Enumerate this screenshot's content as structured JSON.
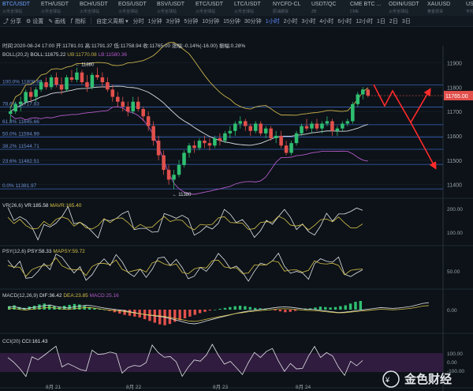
{
  "tickers": [
    {
      "name": "BTC/USDT",
      "sub": "火币全球站",
      "active": true
    },
    {
      "name": "ETH/USDT",
      "sub": "火币全球站"
    },
    {
      "name": "BCH/USDT",
      "sub": "火币全球站"
    },
    {
      "name": "EOS/USDT",
      "sub": "火币全球站"
    },
    {
      "name": "BSV/USDT",
      "sub": "火币全球站"
    },
    {
      "name": "ETC/USDT",
      "sub": "火币全球站"
    },
    {
      "name": "LTC/USDT",
      "sub": "火币全球站"
    },
    {
      "name": "NYCFD-CL",
      "sub": "原油期货"
    },
    {
      "name": "USDT/QC",
      "sub": "ZB"
    },
    {
      "name": "CME BTC ...",
      "sub": "CME"
    },
    {
      "name": "ODIN/USDT",
      "sub": "火币全球站"
    },
    {
      "name": "XAUUSD",
      "sub": "黄金现货"
    },
    {
      "name": "USDT / CNY",
      "sub": "平均价"
    }
  ],
  "toolbar": {
    "share": "分享",
    "settings": "设置",
    "draw": "画线",
    "indicators": "指标",
    "custom": "自定义周期",
    "intervals": [
      "分时",
      "1分钟",
      "3分钟",
      "5分钟",
      "10分钟",
      "15分钟",
      "30分钟",
      "1小时",
      "2小时",
      "3小时",
      "4小时",
      "6小时",
      "12小时",
      "1日",
      "2日",
      "3日"
    ],
    "active_interval": "1小时"
  },
  "chart_data": {
    "type": "candlestick",
    "symbol": "BTC/USDT",
    "info": {
      "time_label": "时间:",
      "time": "2020-08-24 17:00",
      "open_label": "开:",
      "open": "11781.01",
      "high_label": "高:",
      "high": "11791.37",
      "low_label": "低:",
      "low": "11758.94",
      "close_label": "收:",
      "close": "11765.00",
      "chg_label": "涨幅:",
      "chg": "-0.14%(-16.00)",
      "amp_label": "振幅:",
      "amp": "0.28%"
    },
    "boll": {
      "label": "BOLL(20,2)",
      "boll": "BOLL:11675.22",
      "ub": "UB:11770.08",
      "lb": "LB:11580.36"
    },
    "price_axis": {
      "min": 11350,
      "max": 11950,
      "ticks": [
        11900,
        11800,
        11700,
        11600,
        11500,
        11400
      ]
    },
    "current_price": "11765.00",
    "fib": [
      {
        "label": "100.0%",
        "price": "11808.89",
        "value": 11808.89
      },
      {
        "label": "78.6%",
        "price": "11717.83",
        "value": 11717.83
      },
      {
        "label": "61.8%",
        "price": "11645.66",
        "value": 11645.66
      },
      {
        "label": "50.0%",
        "price": "11594.99",
        "value": 11594.99
      },
      {
        "label": "38.2%",
        "price": "11544.71",
        "value": 11544.71
      },
      {
        "label": "23.6%",
        "price": "11482.51",
        "value": 11482.51
      },
      {
        "label": "0.0%",
        "price": "11381.97",
        "value": 11381.97
      }
    ],
    "annotations": {
      "high": "11880",
      "low": "11380"
    },
    "x_labels": [
      "8月 21",
      "8月 22",
      "8月 23",
      "8月 24"
    ],
    "candles": [
      [
        11690,
        11720,
        11660,
        11700
      ],
      [
        11700,
        11740,
        11690,
        11730
      ],
      [
        11730,
        11760,
        11700,
        11740
      ],
      [
        11740,
        11790,
        11730,
        11780
      ],
      [
        11780,
        11800,
        11740,
        11760
      ],
      [
        11760,
        11800,
        11740,
        11790
      ],
      [
        11790,
        11830,
        11780,
        11820
      ],
      [
        11820,
        11840,
        11790,
        11800
      ],
      [
        11800,
        11850,
        11790,
        11840
      ],
      [
        11840,
        11860,
        11800,
        11810
      ],
      [
        11810,
        11840,
        11770,
        11790
      ],
      [
        11790,
        11850,
        11780,
        11840
      ],
      [
        11840,
        11870,
        11820,
        11830
      ],
      [
        11830,
        11880,
        11820,
        11860
      ],
      [
        11860,
        11870,
        11810,
        11820
      ],
      [
        11820,
        11850,
        11780,
        11800
      ],
      [
        11800,
        11860,
        11790,
        11850
      ],
      [
        11850,
        11880,
        11830,
        11840
      ],
      [
        11840,
        11860,
        11800,
        11820
      ],
      [
        11820,
        11840,
        11780,
        11790
      ],
      [
        11790,
        11810,
        11740,
        11760
      ],
      [
        11760,
        11780,
        11720,
        11740
      ],
      [
        11740,
        11760,
        11700,
        11720
      ],
      [
        11720,
        11740,
        11680,
        11700
      ],
      [
        11700,
        11760,
        11690,
        11740
      ],
      [
        11740,
        11760,
        11700,
        11710
      ],
      [
        11710,
        11720,
        11660,
        11680
      ],
      [
        11680,
        11700,
        11620,
        11640
      ],
      [
        11640,
        11660,
        11560,
        11580
      ],
      [
        11580,
        11600,
        11500,
        11520
      ],
      [
        11520,
        11540,
        11440,
        11460
      ],
      [
        11460,
        11480,
        11400,
        11420
      ],
      [
        11420,
        11460,
        11380,
        11440
      ],
      [
        11440,
        11500,
        11430,
        11480
      ],
      [
        11480,
        11540,
        11470,
        11530
      ],
      [
        11530,
        11570,
        11510,
        11560
      ],
      [
        11560,
        11580,
        11530,
        11550
      ],
      [
        11550,
        11590,
        11540,
        11580
      ],
      [
        11580,
        11600,
        11550,
        11570
      ],
      [
        11570,
        11590,
        11540,
        11560
      ],
      [
        11560,
        11600,
        11550,
        11590
      ],
      [
        11590,
        11610,
        11560,
        11580
      ],
      [
        11580,
        11620,
        11570,
        11610
      ],
      [
        11610,
        11640,
        11590,
        11620
      ],
      [
        11620,
        11660,
        11600,
        11650
      ],
      [
        11650,
        11680,
        11630,
        11660
      ],
      [
        11660,
        11670,
        11620,
        11640
      ],
      [
        11640,
        11650,
        11600,
        11620
      ],
      [
        11620,
        11660,
        11610,
        11650
      ],
      [
        11650,
        11660,
        11600,
        11610
      ],
      [
        11610,
        11640,
        11590,
        11630
      ],
      [
        11630,
        11640,
        11580,
        11590
      ],
      [
        11590,
        11620,
        11570,
        11600
      ],
      [
        11600,
        11620,
        11550,
        11560
      ],
      [
        11560,
        11580,
        11520,
        11530
      ],
      [
        11530,
        11580,
        11520,
        11570
      ],
      [
        11570,
        11620,
        11560,
        11610
      ],
      [
        11610,
        11650,
        11600,
        11640
      ],
      [
        11640,
        11670,
        11620,
        11630
      ],
      [
        11630,
        11660,
        11610,
        11650
      ],
      [
        11650,
        11670,
        11620,
        11630
      ],
      [
        11630,
        11660,
        11610,
        11650
      ],
      [
        11650,
        11680,
        11640,
        11660
      ],
      [
        11660,
        11670,
        11600,
        11620
      ],
      [
        11620,
        11640,
        11600,
        11630
      ],
      [
        11630,
        11660,
        11620,
        11650
      ],
      [
        11650,
        11670,
        11640,
        11660
      ],
      [
        11660,
        11740,
        11650,
        11730
      ],
      [
        11730,
        11780,
        11720,
        11770
      ],
      [
        11770,
        11800,
        11750,
        11790
      ],
      [
        11790,
        11795,
        11758,
        11765
      ]
    ],
    "projection": [
      [
        474,
        107
      ],
      [
        488,
        134
      ],
      [
        498,
        115
      ],
      [
        521,
        155
      ],
      [
        545,
        114
      ]
    ],
    "projection_alt": [
      [
        521,
        155
      ],
      [
        552,
        212
      ]
    ],
    "vr": {
      "label": "VR(26,6)",
      "vr": "VR:185.58",
      "mavr": "MAVR:165.40",
      "ticks": [
        "200.00",
        "100.00"
      ]
    },
    "psy": {
      "label": "PSY(12,6)",
      "psy": "PSY:58.33",
      "mapsy": "MAPSY:59.72",
      "tick": "50.00"
    },
    "macd": {
      "label": "MACD(12,26,9)",
      "dif": "DIF:36.42",
      "dea": "DEA:23.85",
      "macd": "MACD:25.16",
      "tick": "0.00",
      "hist": [
        8,
        10,
        6,
        4,
        7,
        9,
        12,
        14,
        10,
        8,
        6,
        9,
        11,
        13,
        12,
        9,
        6,
        4,
        2,
        0,
        -3,
        -6,
        -9,
        -12,
        -14,
        -16,
        -18,
        -22,
        -26,
        -30,
        -34,
        -36,
        -33,
        -28,
        -24,
        -20,
        -16,
        -12,
        -8,
        -5,
        -2,
        0,
        2,
        4,
        6,
        8,
        9,
        8,
        6,
        4,
        3,
        2,
        0,
        -2,
        -4,
        -6,
        -5,
        -3,
        -1,
        1,
        3,
        5,
        7,
        6,
        5,
        6,
        8,
        10,
        14,
        18,
        20
      ]
    },
    "cci": {
      "label": "CCI(20)",
      "cci": "CCI:161.43",
      "ticks": [
        "100.00",
        "0.00",
        "-100.00"
      ]
    }
  },
  "watermark": {
    "text": "金色财经"
  }
}
